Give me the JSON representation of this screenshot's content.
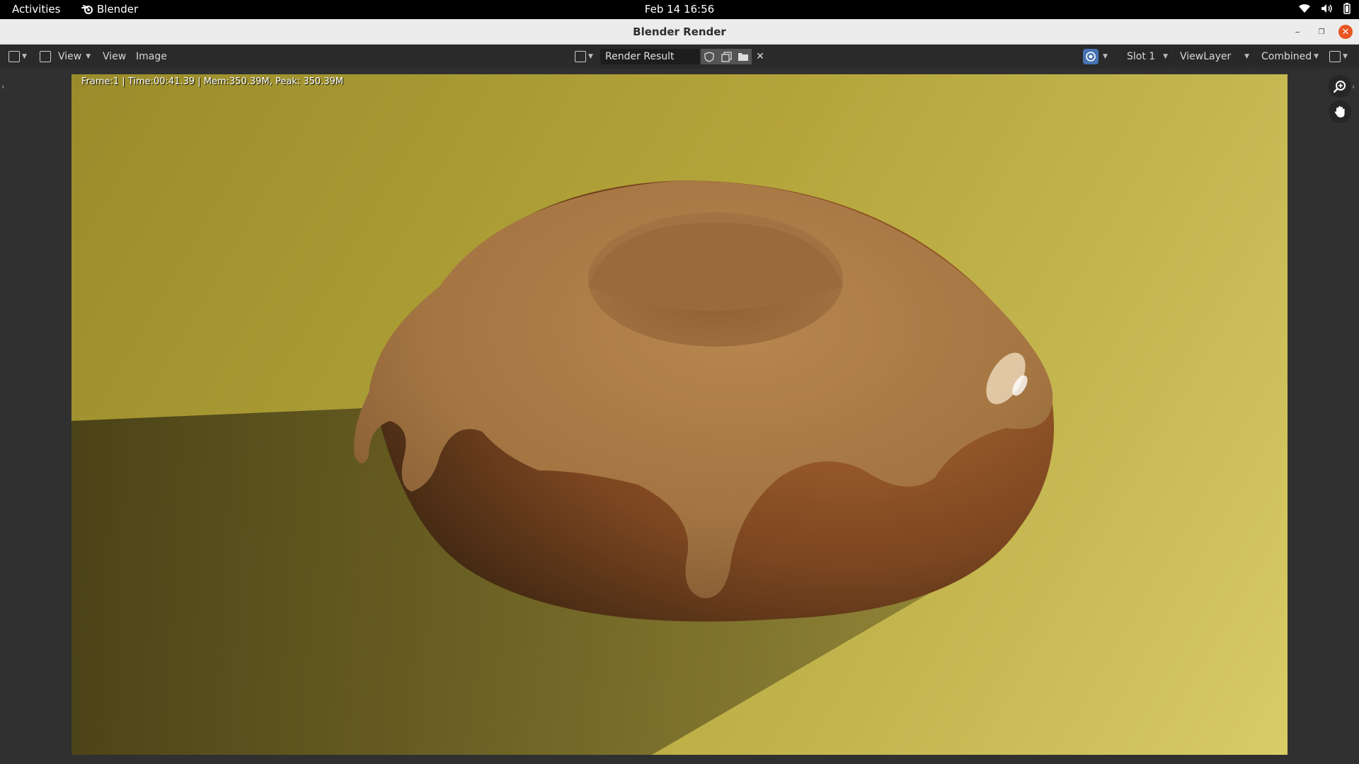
{
  "topbar": {
    "activities": "Activities",
    "app_name": "Blender",
    "clock": "Feb 14  16:56",
    "tray_icons": [
      "wifi-icon",
      "volume-icon",
      "battery-icon"
    ]
  },
  "window": {
    "title": "Blender Render",
    "controls": [
      "minimize",
      "maximize",
      "close"
    ]
  },
  "header": {
    "menus": {
      "view_dropdown": "View",
      "view": "View",
      "image": "Image"
    },
    "image_name": "Render Result",
    "slot": "Slot 1",
    "view_layer": "ViewLayer",
    "pass": "Combined"
  },
  "render": {
    "stats": "Frame:1 | Time:00:41.39 | Mem:350.39M, Peak: 350.39M",
    "subject": "donut with glaze",
    "background_color": "#b3a43a"
  },
  "colors": {
    "accent_blue": "#4772b3",
    "close_orange": "#e95420",
    "header_bg": "#2a2a2a",
    "editor_bg": "#303030"
  }
}
